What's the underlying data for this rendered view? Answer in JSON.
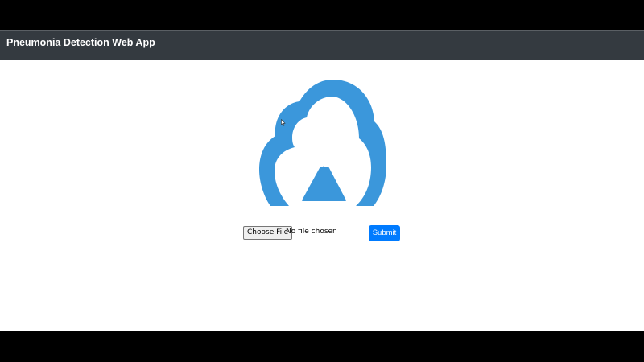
{
  "navbar": {
    "title": "Pneumonia Detection Web App"
  },
  "upload_icon": {
    "icon": "cloud-upload-icon",
    "color": "#3b97db"
  },
  "form": {
    "choose_file_label": "Choose File",
    "file_status": "No file chosen",
    "submit_label": "Submit"
  },
  "colors": {
    "navbar_bg": "#343a40",
    "primary": "#007bff",
    "icon": "#3b97db"
  }
}
